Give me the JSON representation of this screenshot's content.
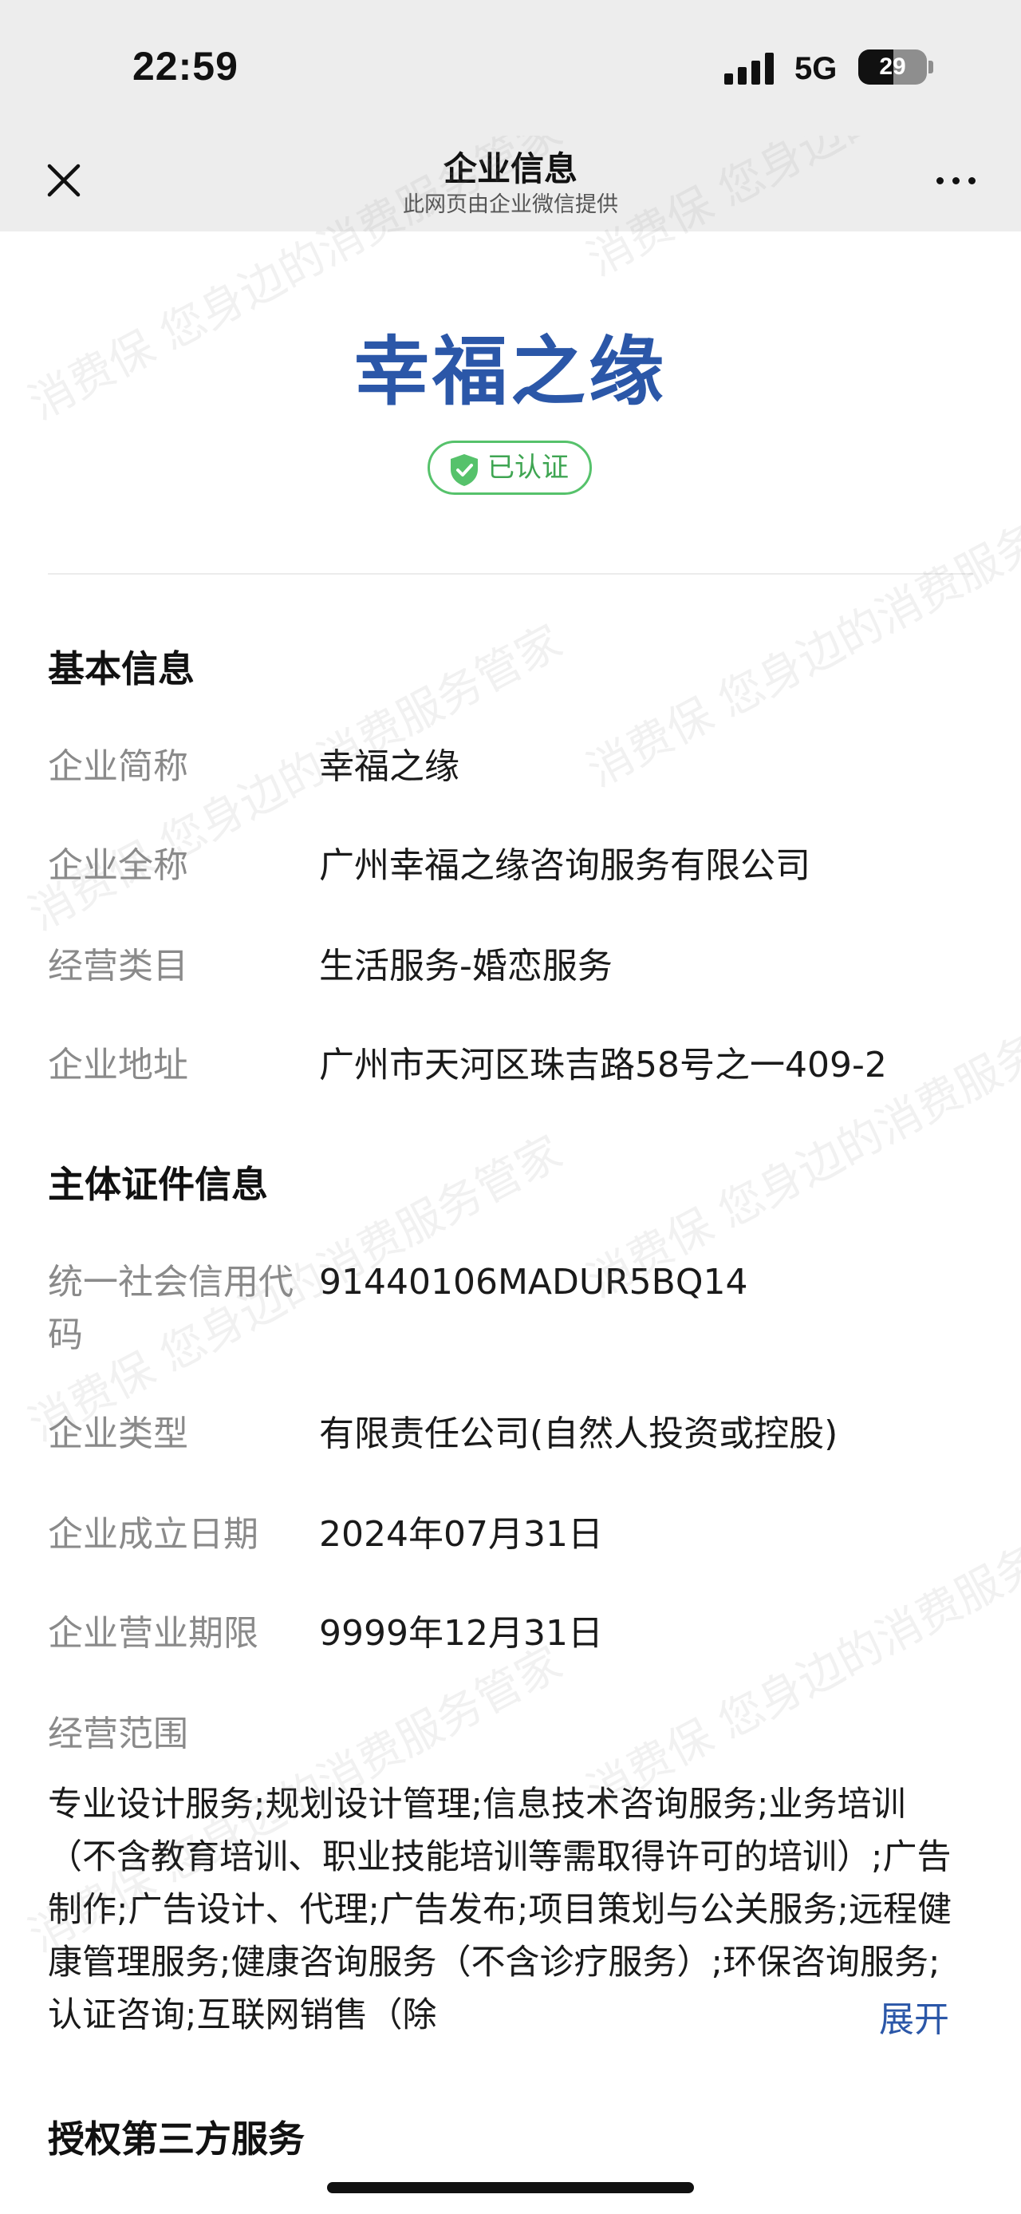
{
  "status_bar": {
    "time": "22:59",
    "network": "5G",
    "battery": "29"
  },
  "nav": {
    "title": "企业信息",
    "subtitle": "此网页由企业微信提供",
    "close_icon": "close-icon",
    "more_icon": "more-dots-icon"
  },
  "watermark": {
    "text": "消费保 您身边的消费服务管家"
  },
  "hero": {
    "company_name": "幸福之缘",
    "verified_label": "已认证",
    "verified_color": "#56c26b",
    "title_color": "#2b57a8"
  },
  "basic_info": {
    "title": "基本信息",
    "rows": [
      {
        "label": "企业简称",
        "value": "幸福之缘"
      },
      {
        "label": "企业全称",
        "value": "广州幸福之缘咨询服务有限公司"
      },
      {
        "label": "经营类目",
        "value": "生活服务-婚恋服务"
      },
      {
        "label": "企业地址",
        "value": "广州市天河区珠吉路58号之一409-2"
      }
    ]
  },
  "license_info": {
    "title": "主体证件信息",
    "rows": [
      {
        "label": "统一社会信用代码",
        "value": "91440106MADUR5BQ14"
      },
      {
        "label": "企业类型",
        "value": "有限责任公司(自然人投资或控股)"
      },
      {
        "label": "企业成立日期",
        "value": "2024年07月31日"
      },
      {
        "label": "企业营业期限",
        "value": "9999年12月31日"
      }
    ],
    "scope_label": "经营范围",
    "scope_text": "专业设计服务;规划设计管理;信息技术咨询服务;业务培训（不含教育培训、职业技能培训等需取得许可的培训）;广告制作;广告设计、代理;广告发布;项目策划与公关服务;远程健康管理服务;健康咨询服务（不含诊疗服务）;环保咨询服务;认证咨询;互联网销售（除",
    "expand_label": "展开"
  },
  "third_party": {
    "title": "授权第三方服务"
  }
}
